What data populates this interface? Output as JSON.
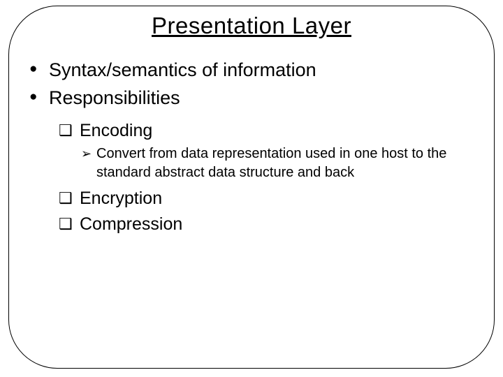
{
  "slide": {
    "title": "Presentation Layer",
    "bullets": {
      "b1": "Syntax/semantics of information",
      "b2": "Responsibilities"
    },
    "sub": {
      "s1": "Encoding",
      "s2": "Encryption",
      "s3": "Compression"
    },
    "detail": {
      "d1": "Convert from data representation used in one host to the standard abstract data structure and back"
    },
    "markers": {
      "square": "❑",
      "arrow": "➢"
    }
  }
}
